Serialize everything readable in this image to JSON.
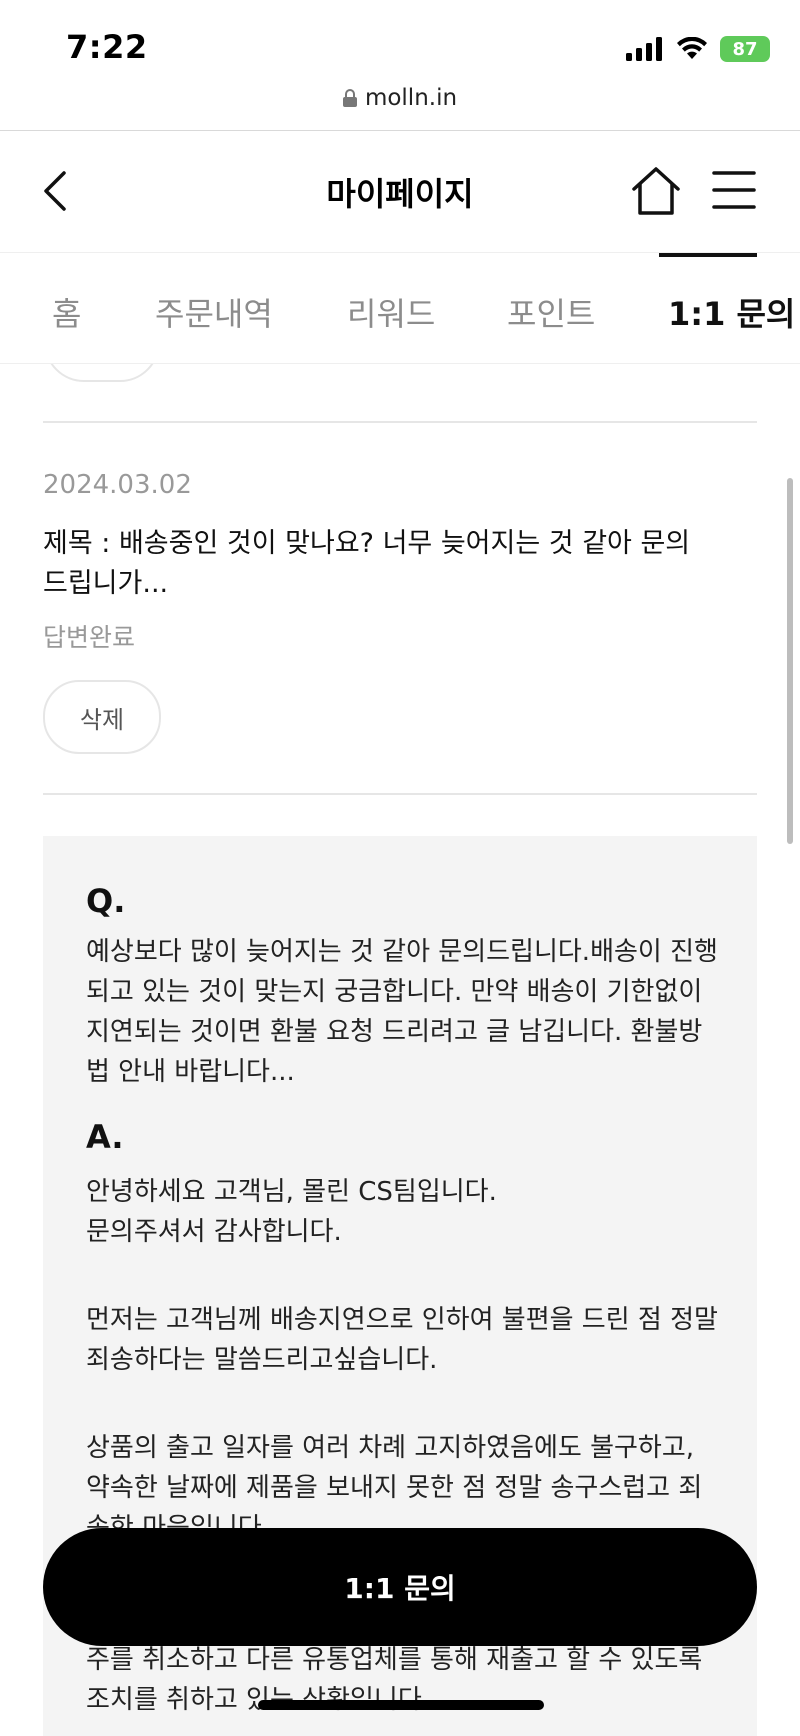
{
  "status_bar": {
    "time": "7:22",
    "battery": "87",
    "icons": [
      "signal-icon",
      "wifi-icon",
      "battery-icon"
    ]
  },
  "browser": {
    "url": "molln.in",
    "lock_icon": "lock-icon"
  },
  "header": {
    "title": "마이페이지",
    "back_icon": "chevron-left-icon",
    "home_icon": "home-icon",
    "menu_icon": "hamburger-menu-icon"
  },
  "tabs": [
    {
      "label": "홈",
      "active": false
    },
    {
      "label": "주문내역",
      "active": false
    },
    {
      "label": "리워드",
      "active": false
    },
    {
      "label": "포인트",
      "active": false
    },
    {
      "label": "1:1 문의",
      "active": true
    }
  ],
  "inquiry": {
    "date": "2024.03.02",
    "title": "제목 : 배송중인 것이 맞나요? 너무 늦어지는 것 같아 문의드립니가...",
    "status": "답변완료",
    "delete_label": "삭제"
  },
  "qa": {
    "q_label": "Q.",
    "question": "예상보다 많이 늦어지는 것 같아 문의드립니다.배송이 진행되고 있는 것이 맞는지 궁금합니다. 만약 배송이 기한없이 지연되는 것이면 환불 요청 드리려고 글 남깁니다. 환불방법 안내 바랍니다...",
    "a_label": "A.",
    "answer_p1": "안녕하세요 고객님, 몰린 CS팀입니다.\n문의주셔서 감사합니다.",
    "answer_p2": "먼저는 고객님께 배송지연으로 인하여 불편을 드린 점 정말 죄송하다는 말씀드리고싶습니다.",
    "answer_p3": "상품의 출고 일자를 여러 차례 고지하였음에도 불구하고, 약속한 날짜에 제품을 보내지 못한 점 정말 송구스럽고 죄송한 마음입니다.",
    "answer_p4": "주를 취소하고 다른 유통업체를 통해 재출고 할 수 있도록 조치를 취하고 있는 상황입니다."
  },
  "floating_button": {
    "label": "1:1 문의"
  },
  "colors": {
    "accent": "#000000",
    "battery": "#5fca5a",
    "muted_text": "#999999",
    "qa_background": "#f4f4f4"
  }
}
